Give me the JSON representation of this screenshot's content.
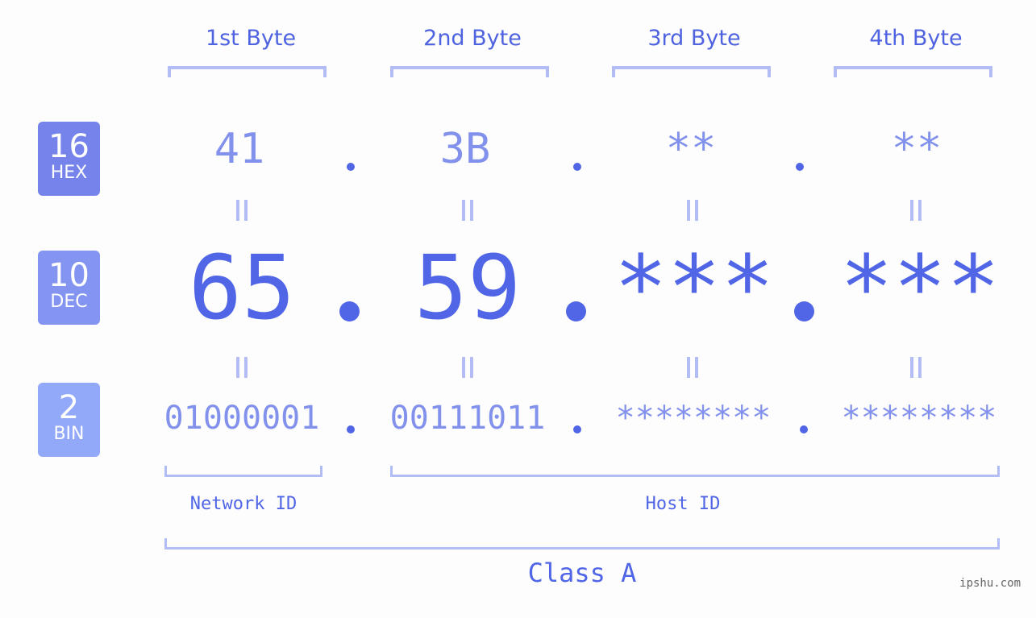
{
  "bytes": {
    "labels": [
      "1st Byte",
      "2nd Byte",
      "3rd Byte",
      "4th Byte"
    ]
  },
  "badges": {
    "hex": {
      "num": "16",
      "sub": "HEX",
      "color": "#7583ea"
    },
    "dec": {
      "num": "10",
      "sub": "DEC",
      "color": "#8494f1"
    },
    "bin": {
      "num": "2",
      "sub": "BIN",
      "color": "#92a8f8"
    }
  },
  "hex": {
    "values": [
      "41",
      "3B",
      "**",
      "**"
    ]
  },
  "dec": {
    "values": [
      "65",
      "59",
      "***",
      "***"
    ]
  },
  "bin": {
    "values": [
      "01000001",
      "00111011",
      "********",
      "********"
    ]
  },
  "separator": ".",
  "ids": {
    "network": "Network ID",
    "host": "Host ID"
  },
  "class_label": "Class A",
  "watermark": "ipshu.com",
  "colors": {
    "primary": "#5166e6",
    "light": "#8291ec",
    "bracket": "#b3bdf5"
  }
}
